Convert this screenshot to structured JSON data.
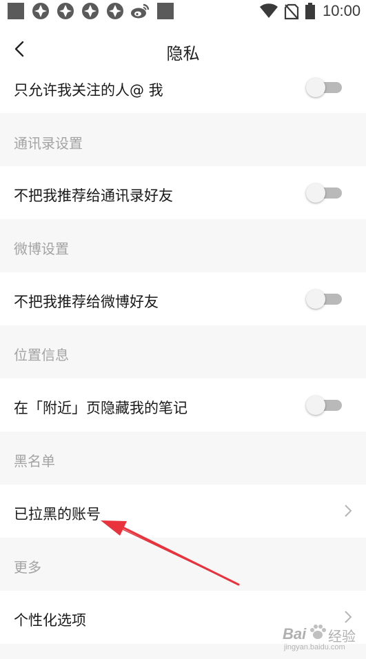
{
  "status_bar": {
    "time": "10:00",
    "left_icons": [
      "app-square-icon",
      "circle-icon",
      "circle-icon",
      "circle-icon",
      "circle-icon",
      "weibo-icon",
      "app-square-icon"
    ],
    "right_icons": [
      "wifi-icon",
      "no-sim-icon",
      "battery-icon"
    ]
  },
  "header": {
    "title": "隐私",
    "back_icon": "chevron-left-icon"
  },
  "rows": {
    "mention_only_following": {
      "label": "只允许我关注的人@ 我",
      "toggle_on": false
    },
    "contacts_section": "通讯录设置",
    "no_recommend_contacts": {
      "label": "不把我推荐给通讯录好友",
      "toggle_on": false
    },
    "weibo_section": "微博设置",
    "no_recommend_weibo": {
      "label": "不把我推荐给微博好友",
      "toggle_on": false
    },
    "location_section": "位置信息",
    "hide_nearby": {
      "label": "在「附近」页隐藏我的笔记",
      "toggle_on": false
    },
    "blacklist_section": "黑名单",
    "blocked_accounts": {
      "label": "已拉黑的账号"
    },
    "more_section": "更多",
    "personalization": {
      "label": "个性化选项"
    }
  },
  "watermark": {
    "brand": "Bai",
    "brand_suffix": "经验",
    "url": "jingyan.baidu.com"
  },
  "colors": {
    "background": "#f7f7f7",
    "row_background": "#ffffff",
    "section_text": "#a3a3a3",
    "toggle_track": "#b9b9b9",
    "annotation_arrow": "#e8323c"
  }
}
